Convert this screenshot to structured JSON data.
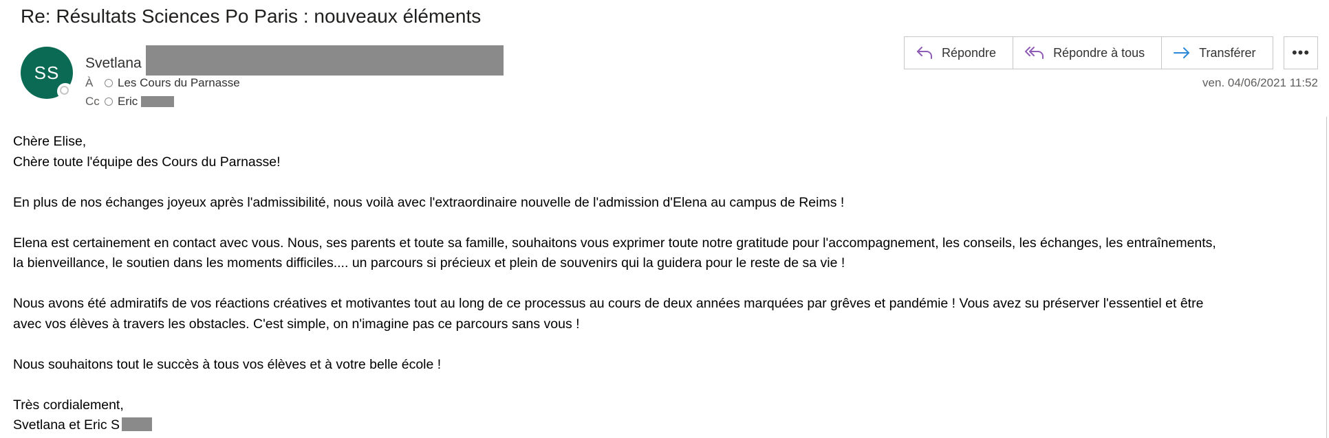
{
  "email": {
    "subject": "Re: Résultats Sciences Po Paris : nouveaux éléments",
    "avatar_initials": "SS",
    "avatar_color": "#0b6a53",
    "sender_name": "Svetlana",
    "to_label": "À",
    "to_name": "Les Cours du Parnasse",
    "cc_label": "Cc",
    "cc_name": "Eric",
    "date": "ven. 04/06/2021 11:52"
  },
  "actions": {
    "reply": "Répondre",
    "reply_all": "Répondre à tous",
    "forward": "Transférer",
    "more": "•••",
    "reply_icon_color": "#8e5bb5",
    "forward_icon_color": "#2b88d8"
  },
  "body": {
    "l1": "Chère Elise,",
    "l2": "Chère toute l'équipe des Cours du Parnasse!",
    "l3": "En plus de nos échanges joyeux après l'admissibilité, nous voilà avec l'extraordinaire nouvelle de l'admission d'Elena au campus de Reims !",
    "l4": "Elena est certainement en contact avec vous. Nous, ses parents et toute sa famille, souhaitons vous exprimer toute notre gratitude pour l'accompagnement, les conseils, les échanges, les entraînements,",
    "l5": "la bienveillance, le soutien dans les moments difficiles.... un parcours si précieux et plein de souvenirs qui la guidera pour le reste de sa vie !",
    "l6": "Nous avons été admiratifs de vos réactions créatives et motivantes tout au long de ce processus au cours de deux années marquées par grêves et pandémie ! Vous avez su préserver l'essentiel et être",
    "l7": "avec vos élèves à travers les obstacles. C'est simple, on n'imagine pas ce parcours sans vous !",
    "l8": "Nous souhaitons tout le succès à tous vos élèves et à votre belle école !",
    "l9": "Très cordialement,",
    "l10": "Svetlana et Eric S"
  }
}
